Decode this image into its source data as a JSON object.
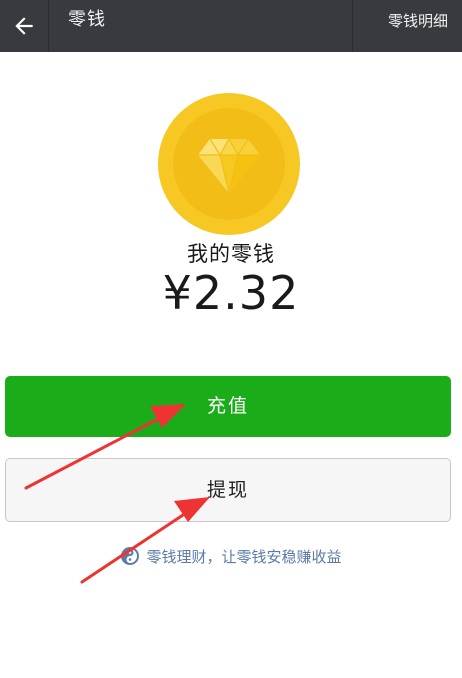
{
  "header": {
    "title": "零钱",
    "detail_link": "零钱明细"
  },
  "balance": {
    "label": "我的零钱",
    "amount": "¥2.32"
  },
  "buttons": {
    "recharge": "充值",
    "withdraw": "提现"
  },
  "promo": {
    "text": "零钱理财，让零钱安稳赚收益"
  },
  "colors": {
    "topbar": "#393a3f",
    "primary_green": "#1aad19",
    "coin": "#f7c824",
    "link_blue": "#5b7ba8",
    "annotation_red": "#ee3333"
  }
}
